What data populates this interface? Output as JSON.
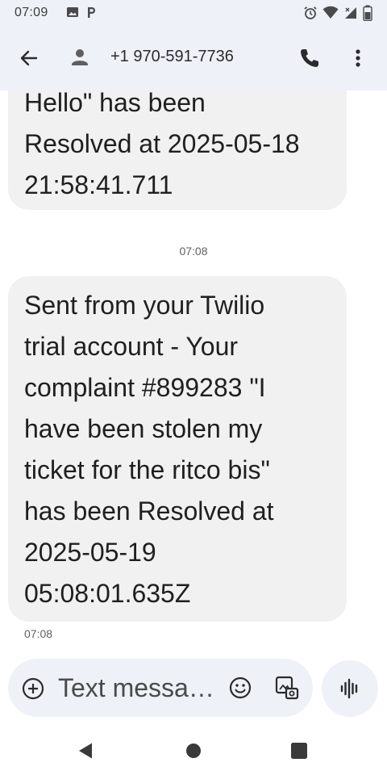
{
  "status_bar": {
    "time": "07:09",
    "icons": [
      "image-icon",
      "parking-icon",
      "alarm-icon",
      "wifi-icon",
      "signal-icon",
      "battery-icon"
    ]
  },
  "app_bar": {
    "contact_number": "+1 970-591-7736",
    "icons": [
      "back-arrow-icon",
      "person-icon",
      "phone-icon",
      "more-vert-icon"
    ]
  },
  "messages": [
    {
      "text": "Hello\" has been\nResolved at 2025-05-18\n21:58:41.711"
    },
    {
      "timestamp": "07:08"
    },
    {
      "text": "Sent from your Twilio\ntrial account - Your\ncomplaint #899283 \"I\nhave been stolen my\nticket for the ritco bis\"\nhas been Resolved at\n2025-05-19\n05:08:01.635Z",
      "timestamp": "07:08"
    }
  ],
  "compose": {
    "placeholder": "Text messa…",
    "icons": [
      "add-circle-icon",
      "emoji-icon",
      "gallery-icon",
      "voice-wave-icon"
    ]
  },
  "colors": {
    "bar_background": "#eef1f8",
    "bubble_background": "#f1f1f1",
    "text": "#1f1f1f",
    "muted": "#5f5f5f"
  }
}
